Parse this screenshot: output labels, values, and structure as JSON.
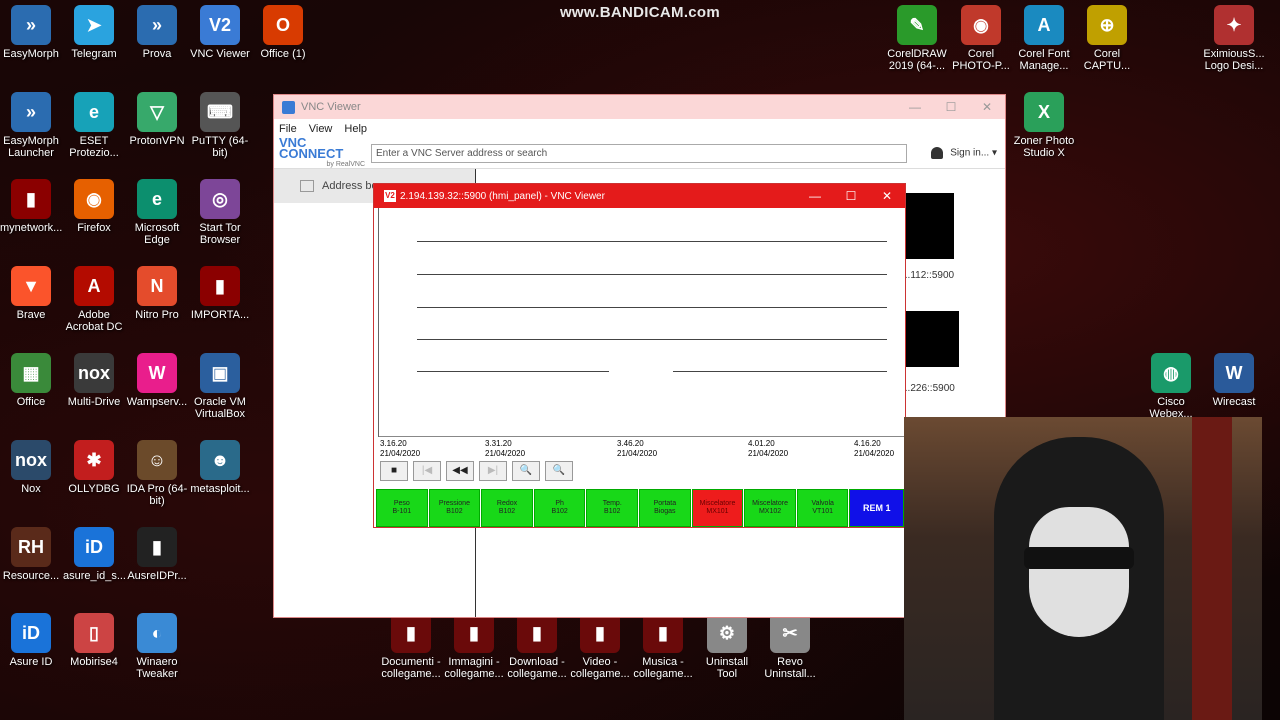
{
  "watermark": "www.BANDICAM.com",
  "desktop_icons_left": [
    {
      "label": "EasyMorph",
      "color": "#2b6cb0",
      "glyph": "»"
    },
    {
      "label": "Telegram",
      "color": "#2aa3df",
      "glyph": "➤"
    },
    {
      "label": "Prova",
      "color": "#2b6cb0",
      "glyph": "»"
    },
    {
      "label": "VNC Viewer",
      "color": "#3a7bd5",
      "glyph": "V2"
    },
    {
      "label": "Office (1)",
      "color": "#d83b01",
      "glyph": "O"
    },
    {
      "label": "EasyMorph Launcher",
      "color": "#2b6cb0",
      "glyph": "»"
    },
    {
      "label": "ESET Protezio...",
      "color": "#17a2b8",
      "glyph": "e"
    },
    {
      "label": "ProtonVPN",
      "color": "#37a96b",
      "glyph": "▽"
    },
    {
      "label": "PuTTY (64-bit)",
      "color": "#555",
      "glyph": "⌨"
    },
    {
      "label": "mynetwork...",
      "color": "#8b0000",
      "glyph": "▮"
    },
    {
      "label": "Firefox",
      "color": "#e66000",
      "glyph": "◉"
    },
    {
      "label": "Microsoft Edge",
      "color": "#0c8f6e",
      "glyph": "e"
    },
    {
      "label": "Start Tor Browser",
      "color": "#7d4698",
      "glyph": "◎"
    },
    {
      "label": "Brave",
      "color": "#fb542b",
      "glyph": "▼"
    },
    {
      "label": "Adobe Acrobat DC",
      "color": "#b30b00",
      "glyph": "A"
    },
    {
      "label": "Nitro Pro",
      "color": "#e44c2c",
      "glyph": "N"
    },
    {
      "label": "IMPORTA...",
      "color": "#8b0000",
      "glyph": "▮"
    },
    {
      "label": "Office",
      "color": "#3a8a3a",
      "glyph": "▦"
    },
    {
      "label": "Multi-Drive",
      "color": "#3a3a3a",
      "glyph": "nox"
    },
    {
      "label": "Wampserv...",
      "color": "#e91e8c",
      "glyph": "W"
    },
    {
      "label": "Oracle VM VirtualBox",
      "color": "#2b5f9e",
      "glyph": "▣"
    },
    {
      "label": "Nox",
      "color": "#2b4a6a",
      "glyph": "nox"
    },
    {
      "label": "OLLYDBG",
      "color": "#c21e1e",
      "glyph": "✱"
    },
    {
      "label": "IDA Pro (64-bit)",
      "color": "#6b4a2a",
      "glyph": "☺"
    },
    {
      "label": "metasploit...",
      "color": "#2a6a8a",
      "glyph": "☻"
    },
    {
      "label": "Resource...",
      "color": "#5a2a1a",
      "glyph": "RH"
    },
    {
      "label": "asure_id_s...",
      "color": "#1a73d9",
      "glyph": "iD"
    },
    {
      "label": "AusreIDPr...",
      "color": "#222",
      "glyph": "▮"
    },
    {
      "label": "Asure ID",
      "color": "#1a73d9",
      "glyph": "iD"
    },
    {
      "label": "Mobirise4",
      "color": "#c44",
      "glyph": "▯"
    },
    {
      "label": "Winaero Tweaker",
      "color": "#3a8ad5",
      "glyph": "◐"
    }
  ],
  "desktop_icons_right": [
    {
      "label": "CorelDRAW 2019 (64-...",
      "color": "#2a9a2a",
      "glyph": "✎"
    },
    {
      "label": "Corel PHOTO-P...",
      "color": "#c0392b",
      "glyph": "◉"
    },
    {
      "label": "Corel Font Manage...",
      "color": "#1a8ac0",
      "glyph": "A"
    },
    {
      "label": "Corel CAPTU...",
      "color": "#c0a000",
      "glyph": "⊕"
    },
    {
      "label": "EximiousS... Logo Desi...",
      "color": "#b03030",
      "glyph": "✦"
    },
    {
      "label": "Zoner Photo Studio X",
      "color": "#2aa05a",
      "glyph": "X"
    },
    {
      "label": "Cisco Webex...",
      "color": "#1a9a6a",
      "glyph": "◍"
    },
    {
      "label": "Wirecast",
      "color": "#2a5a9a",
      "glyph": "W"
    }
  ],
  "desktop_icons_bottom": [
    {
      "label": "Documenti - collegame...",
      "color": "#6a0a0a",
      "glyph": "▮"
    },
    {
      "label": "Immagini - collegame...",
      "color": "#6a0a0a",
      "glyph": "▮"
    },
    {
      "label": "Download - collegame...",
      "color": "#6a0a0a",
      "glyph": "▮"
    },
    {
      "label": "Video - collegame...",
      "color": "#6a0a0a",
      "glyph": "▮"
    },
    {
      "label": "Musica - collegame...",
      "color": "#6a0a0a",
      "glyph": "▮"
    },
    {
      "label": "Uninstall Tool",
      "color": "#888",
      "glyph": "⚙"
    },
    {
      "label": "Revo Uninstall...",
      "color": "#888",
      "glyph": "✂"
    }
  ],
  "vnc_main": {
    "title": "VNC Viewer",
    "menu": [
      "File",
      "View",
      "Help"
    ],
    "logo": "VNC CONNECT",
    "logo_sub": "by RealVNC",
    "address_placeholder": "Enter a VNC Server address or search",
    "sign_in": "Sign in...",
    "address_book": "Address bo",
    "thumb_labels": [
      "...112::5900",
      "...226::5900"
    ]
  },
  "vnc_inner": {
    "title": "2.194.139.32::5900 (hmi_panel) - VNC Viewer",
    "time_labels": [
      {
        "time": "3.16.20",
        "date": "21/04/2020"
      },
      {
        "time": "3.31.20",
        "date": "21/04/2020"
      },
      {
        "time": "3.46.20",
        "date": "21/04/2020"
      },
      {
        "time": "4.01.20",
        "date": "21/04/2020"
      },
      {
        "time": "4.16.20",
        "date": "21/04/2020"
      }
    ],
    "controls": [
      "■",
      "|◀",
      "◀◀",
      "▶|",
      "🔍",
      "🔍"
    ],
    "hmi_buttons": [
      {
        "line1": "Peso",
        "line2": "B-101",
        "state": "green"
      },
      {
        "line1": "Pressione",
        "line2": "B102",
        "state": "green"
      },
      {
        "line1": "Redox",
        "line2": "B102",
        "state": "green"
      },
      {
        "line1": "Ph",
        "line2": "B102",
        "state": "green"
      },
      {
        "line1": "Temp.",
        "line2": "B102",
        "state": "green"
      },
      {
        "line1": "Portata",
        "line2": "Biogas",
        "state": "green"
      },
      {
        "line1": "Miscelatore",
        "line2": "MX101",
        "state": "red"
      },
      {
        "line1": "Miscelatore",
        "line2": "MX102",
        "state": "green"
      },
      {
        "line1": "Valvola",
        "line2": "VT101",
        "state": "green"
      },
      {
        "line1": "REM 1",
        "line2": "",
        "state": "blue"
      }
    ]
  }
}
